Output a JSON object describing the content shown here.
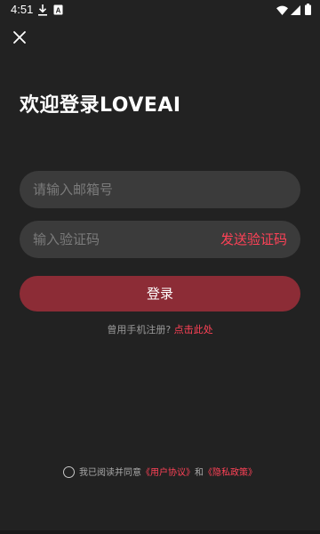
{
  "status_bar": {
    "time": "4:51"
  },
  "header": {
    "title": "欢迎登录LOVEAI"
  },
  "form": {
    "email_placeholder": "请输入邮箱号",
    "code_placeholder": "输入验证码",
    "send_code_label": "发送验证码",
    "login_label": "登录"
  },
  "phone_register": {
    "prompt": "曾用手机注册?",
    "link": "点击此处"
  },
  "agreement": {
    "prefix": "我已阅读并同意",
    "user_agreement": "《用户协议》",
    "and": "和",
    "privacy_policy": "《隐私政策》"
  },
  "colors": {
    "background": "#222222",
    "input_bg": "#3b3b3b",
    "accent": "#ff4257",
    "button_bg": "#8c2c36"
  },
  "icons": [
    "download-icon",
    "sim-icon",
    "wifi-icon",
    "signal-icon",
    "battery-icon",
    "close-icon"
  ]
}
